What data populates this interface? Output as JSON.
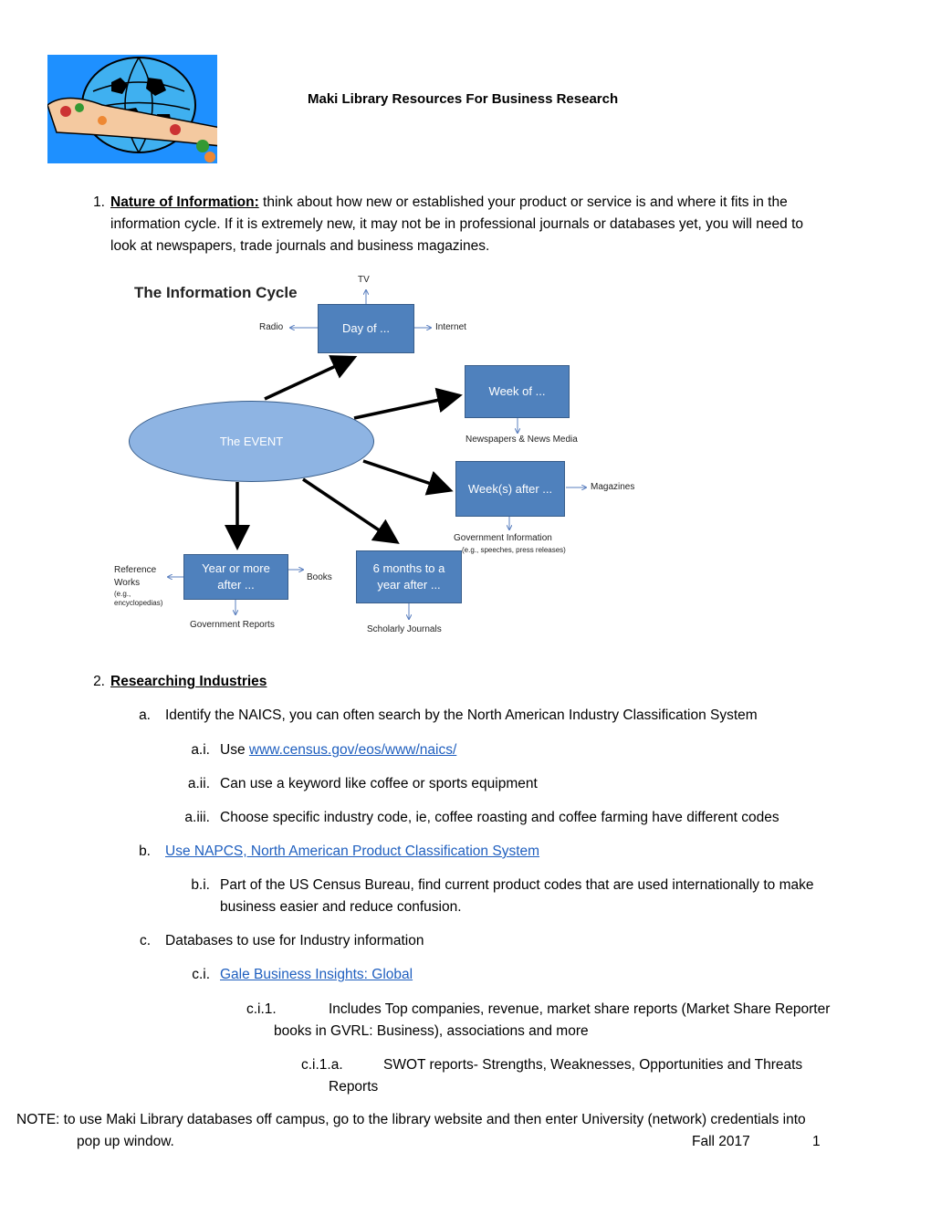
{
  "document": {
    "title": "Maki Library Resources For Business Research",
    "logo_icon": "globe-with-food-icon"
  },
  "section1": {
    "number": "1.",
    "heading": "Nature of Information:",
    "text_line1": " think about how new or established your product or service is and where it fits in the",
    "text_line2": "information cycle. If it is extremely new, it may not be in professional journals or databases yet, you will need to",
    "text_line3": "look at newspapers, trade journals and business magazines."
  },
  "diagram": {
    "title": "The Information Cycle",
    "event": "The EVENT",
    "boxes": {
      "day_of": "Day of ...",
      "week_of": "Week of ...",
      "weeks_after": "Week(s) after ...",
      "year_after_l1": "Year or more",
      "year_after_l2": "after ...",
      "six_months_l1": "6 months to a",
      "six_months_l2": "year after ..."
    },
    "labels": {
      "tv": "TV",
      "radio": "Radio",
      "internet": "Internet",
      "newspapers": "Newspapers & News Media",
      "magazines": "Magazines",
      "gov_info": "Government Information",
      "gov_info_sub": "(e.g., speeches, press releases)",
      "reference_l1": "Reference",
      "reference_l2": "Works",
      "reference_sub1": "(e.g.,",
      "reference_sub2": "encyclopedias)",
      "books": "Books",
      "gov_reports": "Government Reports",
      "scholarly": "Scholarly Journals"
    }
  },
  "section2": {
    "number": "2.",
    "heading": "Researching Industries",
    "a": {
      "marker": "a.",
      "text": "Identify the NAICS, you can often search by the North American Industry Classification System"
    },
    "a_i": {
      "marker": "a.i.",
      "text": "Use ",
      "link": "www.census.gov/eos/www/naics/"
    },
    "a_ii": {
      "marker": "a.ii.",
      "text": "Can use a keyword like coffee or sports equipment"
    },
    "a_iii": {
      "marker": "a.iii.",
      "text": "Choose specific industry code, ie, coffee roasting and coffee farming have different codes"
    },
    "b": {
      "marker": "b.",
      "link": "Use NAPCS, North American Product Classification System"
    },
    "b_i": {
      "marker": "b.i.",
      "line1": "Part of the US Census Bureau, find current product codes that are used internationally to make",
      "line2": "business easier and reduce confusion."
    },
    "c": {
      "marker": "c.",
      "text": "Databases to use for Industry information"
    },
    "c_i": {
      "marker": "c.i.",
      "link": "Gale Business Insights: Global"
    },
    "c_i_1": {
      "marker": "c.i.1.",
      "line1": "Includes Top companies, revenue, market share reports (Market Share Reporter",
      "line2": "books in GVRL: Business), associations and more"
    },
    "c_i_1_a": {
      "marker": "c.i.1.a.",
      "line1": "SWOT reports- Strengths, Weaknesses, Opportunities and Threats",
      "line2": "Reports"
    }
  },
  "footer": {
    "line1": "NOTE: to use Maki Library databases off campus, go to the library website and then enter University (network) credentials into",
    "line2": "pop up window.",
    "term": "Fall 2017",
    "page": "1"
  }
}
